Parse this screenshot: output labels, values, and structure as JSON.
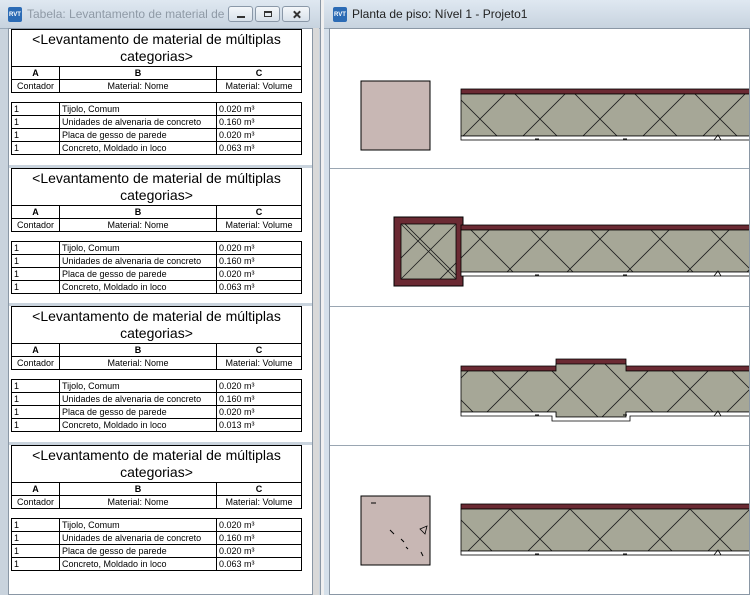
{
  "schedule_window": {
    "title": "Tabela: Levantamento de material de múl...",
    "icon": "revit-icon",
    "icon_text": "RVT",
    "schedules": [
      {
        "header": "<Levantamento de material de múltiplas categorias>",
        "col_letters": [
          "A",
          "B",
          "C"
        ],
        "col_names": [
          "Contador",
          "Material: Nome",
          "Material: Volume"
        ],
        "rows": [
          [
            "1",
            "Tijolo, Comum",
            "0.020 m³"
          ],
          [
            "1",
            "Unidades de alvenaria de concreto",
            "0.160 m³"
          ],
          [
            "1",
            "Placa de gesso de parede",
            "0.020 m³"
          ],
          [
            "1",
            "Concreto,  Moldado in loco",
            "0.063 m³"
          ]
        ]
      },
      {
        "header": "<Levantamento de material de múltiplas categorias>",
        "col_letters": [
          "A",
          "B",
          "C"
        ],
        "col_names": [
          "Contador",
          "Material: Nome",
          "Material: Volume"
        ],
        "rows": [
          [
            "1",
            "Tijolo, Comum",
            "0.020 m³"
          ],
          [
            "1",
            "Unidades de alvenaria de concreto",
            "0.160 m³"
          ],
          [
            "1",
            "Placa de gesso de parede",
            "0.020 m³"
          ],
          [
            "1",
            "Concreto,  Moldado in loco",
            "0.063 m³"
          ]
        ]
      },
      {
        "header": "<Levantamento de material de múltiplas categorias>",
        "col_letters": [
          "A",
          "B",
          "C"
        ],
        "col_names": [
          "Contador",
          "Material: Nome",
          "Material: Volume"
        ],
        "rows": [
          [
            "1",
            "Tijolo, Comum",
            "0.020 m³"
          ],
          [
            "1",
            "Unidades de alvenaria de concreto",
            "0.160 m³"
          ],
          [
            "1",
            "Placa de gesso de parede",
            "0.020 m³"
          ],
          [
            "1",
            "Concreto,  Moldado in loco",
            "0.013 m³"
          ]
        ]
      },
      {
        "header": "<Levantamento de material de múltiplas categorias>",
        "col_letters": [
          "A",
          "B",
          "C"
        ],
        "col_names": [
          "Contador",
          "Material: Nome",
          "Material: Volume"
        ],
        "rows": [
          [
            "1",
            "Tijolo, Comum",
            "0.020 m³"
          ],
          [
            "1",
            "Unidades de alvenaria de concreto",
            "0.160 m³"
          ],
          [
            "1",
            "Placa de gesso de parede",
            "0.020 m³"
          ],
          [
            "1",
            "Concreto,  Moldado in loco",
            "0.063 m³"
          ]
        ]
      }
    ]
  },
  "floorplan_window": {
    "title": "Planta de piso: Nível 1 - Projeto1",
    "icon": "revit-icon",
    "icon_text": "RVT"
  },
  "colors": {
    "wall_core": "#a6a797",
    "brick": "#6b2a33",
    "concrete": "#c8b7b4",
    "window_frame": "#c9d3dd"
  }
}
